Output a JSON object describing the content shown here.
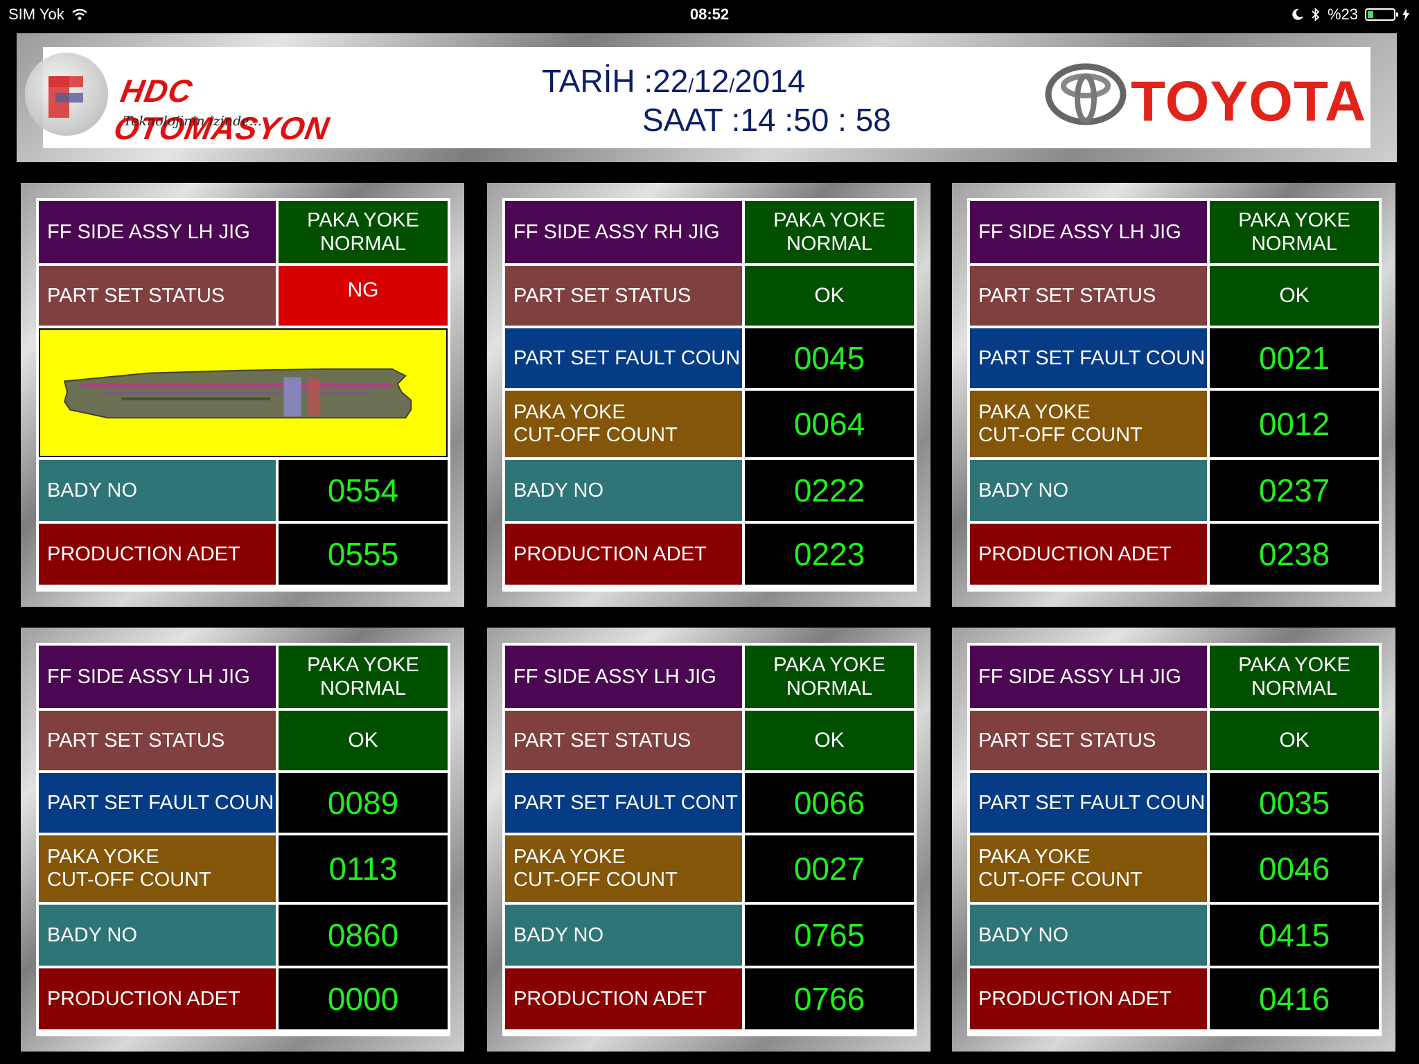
{
  "statusbar": {
    "carrier": "SIM Yok",
    "time": "08:52",
    "battery_text": "%23",
    "battery_percent": 23
  },
  "header": {
    "company_name": "HDC OTOMASYON",
    "company_tagline": "Teknolojinin izinde...",
    "date_label": "TARİH :",
    "date_day": "22",
    "date_month": "12",
    "date_year": "2014",
    "date_sep": "/",
    "time_label": "SAAT :",
    "time_hour": "14",
    "time_minute": "50",
    "time_second": "58",
    "time_sep": ":",
    "brand": "TOYOTA"
  },
  "panels": [
    {
      "jig": "FF SIDE ASSY LH JIG",
      "mode_line1": "PAKA YOKE",
      "mode_line2": "NORMAL",
      "status_label": "PART SET STATUS",
      "status": "NG",
      "fault_label": "",
      "fault_count": "",
      "cutoff_line1": "",
      "cutoff_line2": "",
      "cutoff_count": "",
      "body_label": "BADY NO",
      "body_no": "0554",
      "production_label": "PRODUCTION ADET",
      "production": "0555",
      "shows_part_image": true
    },
    {
      "jig": "FF SIDE ASSY RH JIG",
      "mode_line1": "PAKA YOKE",
      "mode_line2": "NORMAL",
      "status_label": "PART SET STATUS",
      "status": "OK",
      "fault_label": "PART SET FAULT COUN",
      "fault_count": "0045",
      "cutoff_line1": "PAKA YOKE",
      "cutoff_line2": "CUT-OFF COUNT",
      "cutoff_count": "0064",
      "body_label": "BADY NO",
      "body_no": "0222",
      "production_label": "PRODUCTION ADET",
      "production": "0223",
      "shows_part_image": false
    },
    {
      "jig": "FF SIDE ASSY LH JIG",
      "mode_line1": "PAKA YOKE",
      "mode_line2": "NORMAL",
      "status_label": "PART SET STATUS",
      "status": "OK",
      "fault_label": "PART SET FAULT COUN",
      "fault_count": "0021",
      "cutoff_line1": "PAKA YOKE",
      "cutoff_line2": "CUT-OFF COUNT",
      "cutoff_count": "0012",
      "body_label": "BADY NO",
      "body_no": "0237",
      "production_label": "PRODUCTION ADET",
      "production": "0238",
      "shows_part_image": false
    },
    {
      "jig": "FF SIDE ASSY LH JIG",
      "mode_line1": "PAKA YOKE",
      "mode_line2": "NORMAL",
      "status_label": "PART SET STATUS",
      "status": "OK",
      "fault_label": "PART SET FAULT COUN",
      "fault_count": "0089",
      "cutoff_line1": "PAKA YOKE",
      "cutoff_line2": "CUT-OFF COUNT",
      "cutoff_count": "0113",
      "body_label": "BADY NO",
      "body_no": "0860",
      "production_label": "PRODUCTION ADET",
      "production": "0000",
      "shows_part_image": false
    },
    {
      "jig": "FF SIDE ASSY LH JIG",
      "mode_line1": "PAKA YOKE",
      "mode_line2": "NORMAL",
      "status_label": "PART SET STATUS",
      "status": "OK",
      "fault_label": "PART SET FAULT CONT",
      "fault_count": "0066",
      "cutoff_line1": "PAKA YOKE",
      "cutoff_line2": "CUT-OFF COUNT",
      "cutoff_count": "0027",
      "body_label": "BADY NO",
      "body_no": "0765",
      "production_label": "PRODUCTION ADET",
      "production": "0766",
      "shows_part_image": false
    },
    {
      "jig": "FF SIDE ASSY LH JIG",
      "mode_line1": "PAKA YOKE",
      "mode_line2": "NORMAL",
      "status_label": "PART SET STATUS",
      "status": "OK",
      "fault_label": "PART SET FAULT COUN",
      "fault_count": "0035",
      "cutoff_line1": "PAKA YOKE",
      "cutoff_line2": "CUT-OFF COUNT",
      "cutoff_count": "0046",
      "body_label": "BADY NO",
      "body_no": "0415",
      "production_label": "PRODUCTION ADET",
      "production": "0416",
      "shows_part_image": false
    }
  ],
  "colors": {
    "jig_label": "#4b0752",
    "status_label": "#804040",
    "fault_label": "#053c85",
    "cutoff_label": "#83560a",
    "body_label": "#2f7578",
    "production_label": "#890000",
    "ok": "#005000",
    "ng": "#d80000",
    "counter_text": "#1df21d",
    "image_background": "#ffff00",
    "brand_red": "#e2231a",
    "datetime_text": "#0c1e66"
  }
}
